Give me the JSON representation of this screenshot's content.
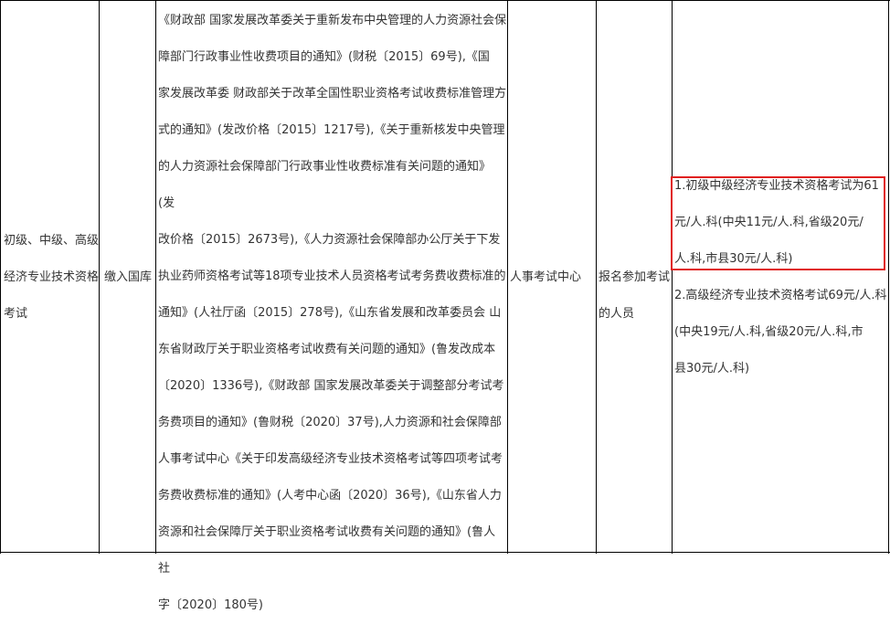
{
  "table": {
    "row": {
      "exam_name": "初级、中级、高级\n经济专业技术资格\n考试",
      "payment": "缴入国库",
      "basis": "《财政部 国家发展改革委关于重新发布中央管理的人力资源社会保\n障部门行政事业性收费项目的通知》(财税〔2015〕69号),《国\n家发展改革委 财政部关于改革全国性职业资格考试收费标准管理方\n式的通知》(发改价格〔2015〕1217号),《关于重新核发中央管理\n的人力资源社会保障部门行政事业性收费标准有关问题的通知》(发\n改价格〔2015〕2673号),《人力资源社会保障部办公厅关于下发\n执业药师资格考试等18项专业技术人员资格考试考务费收费标准的\n通知》(人社厅函〔2015〕278号),《山东省发展和改革委员会 山\n东省财政厅关于职业资格考试收费有关问题的通知》(鲁发改成本\n〔2020〕1336号),《财政部 国家发展改革委关于调整部分考试考\n务费项目的通知》(鲁财税〔2020〕37号),人力资源和社会保障部\n人事考试中心《关于印发高级经济专业技术资格考试等四项考试考\n务费收费标准的通知》(人考中心函〔2020〕36号),《山东省人力\n资源和社会保障厅关于职业资格考试收费有关问题的通知》(鲁人社\n字〔2020〕180号)",
      "collector": "人事考试中心",
      "payer": "报名参加考试\n的人员",
      "fee_standard_1": "1.初级中级经济专业技术资格考试为61\n元/人.科(中央11元/人.科,省级20元/\n人.科,市县30元/人.科)",
      "fee_standard_2": "2.高级经济专业技术资格考试69元/人.科\n (中央19元/人.科,省级20元/人.科,市\n县30元/人.科)"
    }
  },
  "colors": {
    "border": "#000000",
    "text": "#333333",
    "highlight": "#e0201f"
  }
}
